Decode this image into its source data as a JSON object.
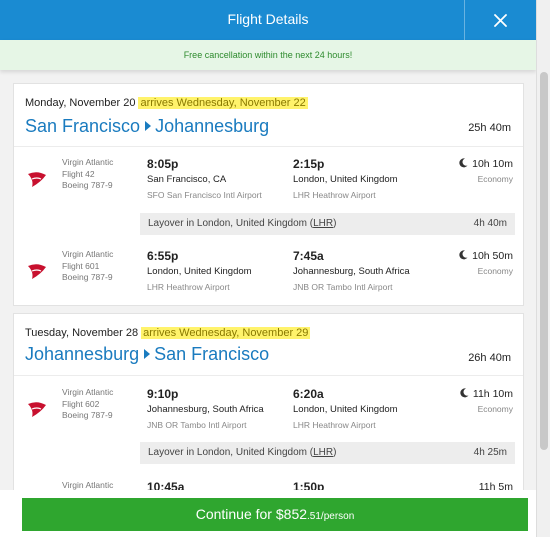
{
  "header": {
    "title": "Flight Details",
    "close_icon": "close-icon"
  },
  "notice": "Free cancellation within the next 24 hours!",
  "trips": [
    {
      "date": "Monday, November 20",
      "arrives": "arrives Wednesday, November 22",
      "from": "San Francisco",
      "to": "Johannesburg",
      "total": "25h 40m",
      "segments": [
        {
          "airline": "Virgin Atlantic",
          "flight": "Flight 42",
          "aircraft": "Boeing 787-9",
          "dep_time": "8:05p",
          "dep_city": "San Francisco, CA",
          "dep_airport": "SFO San Francisco Intl Airport",
          "arr_time": "2:15p",
          "arr_city": "London, United Kingdom",
          "arr_airport": "LHR Heathrow Airport",
          "duration": "10h 10m",
          "cabin": "Economy"
        },
        {
          "airline": "Virgin Atlantic",
          "flight": "Flight 601",
          "aircraft": "Boeing 787-9",
          "dep_time": "6:55p",
          "dep_city": "London, United Kingdom",
          "dep_airport": "LHR Heathrow Airport",
          "arr_time": "7:45a",
          "arr_city": "Johannesburg, South Africa",
          "arr_airport": "JNB OR Tambo Intl Airport",
          "duration": "10h 50m",
          "cabin": "Economy"
        }
      ],
      "layover": {
        "text": "Layover in London, United Kingdom (",
        "code": "LHR",
        "close": ")",
        "duration": "4h 40m"
      }
    },
    {
      "date": "Tuesday, November 28",
      "arrives": "arrives Wednesday, November 29",
      "from": "Johannesburg",
      "to": "San Francisco",
      "total": "26h 40m",
      "segments": [
        {
          "airline": "Virgin Atlantic",
          "flight": "Flight 602",
          "aircraft": "Boeing 787-9",
          "dep_time": "9:10p",
          "dep_city": "Johannesburg, South Africa",
          "dep_airport": "JNB OR Tambo Intl Airport",
          "arr_time": "6:20a",
          "arr_city": "London, United Kingdom",
          "arr_airport": "LHR Heathrow Airport",
          "duration": "11h 10m",
          "cabin": "Economy"
        },
        {
          "airline": "Virgin Atlantic",
          "dep_time": "10:45a",
          "arr_time": "1:50p",
          "duration": "11h 5m"
        }
      ],
      "layover": {
        "text": "Layover in London, United Kingdom (",
        "code": "LHR",
        "close": ")",
        "duration": "4h 25m"
      }
    }
  ],
  "cta": {
    "label": "Continue for ",
    "price": "$852",
    "cents": ".51/person"
  },
  "colors": {
    "header": "#1a8bd2",
    "link": "#1a7bbf",
    "highlight": "#fff36b",
    "cta": "#2fa62f",
    "notice_text": "#2e8b2e"
  }
}
